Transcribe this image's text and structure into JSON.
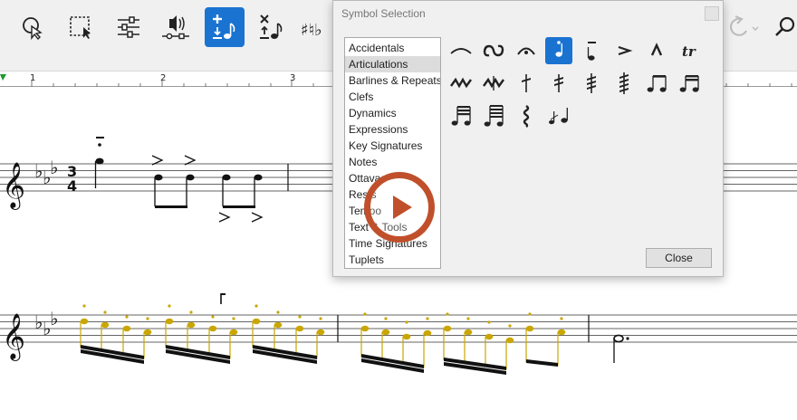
{
  "colors": {
    "accent": "#1a73d1",
    "selection_notes": "#c9a600",
    "play_overlay": "#c0502b"
  },
  "toolbar": {
    "buttons": [
      {
        "name": "select-tool",
        "icon": "cursor-icon"
      },
      {
        "name": "marquee-select",
        "icon": "marquee-select-icon"
      },
      {
        "name": "mixer",
        "icon": "sliders-icon"
      },
      {
        "name": "audio-playback",
        "icon": "speaker-icon"
      },
      {
        "name": "note-input",
        "icon": "note-input-icon",
        "active": true
      },
      {
        "name": "note-cross",
        "icon": "cross-note-icon"
      },
      {
        "name": "accidentals",
        "icon": "accidentals-icon"
      },
      {
        "name": "redo",
        "icon": "redo-icon"
      },
      {
        "name": "search",
        "icon": "search-icon"
      }
    ]
  },
  "ruler": {
    "labels": [
      "1",
      "2",
      "3"
    ]
  },
  "dialog": {
    "title": "Symbol Selection",
    "categories": [
      "Accidentals",
      "Articulations",
      "Barlines & Repeats",
      "Clefs",
      "Dynamics",
      "Expressions",
      "Key Signatures",
      "Notes",
      "Ottavas",
      "Rests",
      "Tempo",
      "Text & Tools",
      "Time Signatures",
      "Tuplets"
    ],
    "selected_category": "Articulations",
    "symbols": [
      "slur-icon",
      "turn-icon",
      "fermata-icon",
      "staccato-icon",
      "tenuto-icon",
      "accent-icon",
      "marcato-icon",
      "trill-icon",
      "mordent-icon",
      "inverted-mordent-icon",
      "single-tremolo-icon",
      "double-tremolo-icon",
      "triple-tremolo-icon",
      "quadruple-tremolo-icon",
      "eighth-beam-icon",
      "sixteenth-beam-icon",
      "thirtysecond-beam-icon",
      "sixtyfourth-beam-icon",
      "arpeggio-icon",
      "grace-note-icon"
    ],
    "symbol_labels": {
      "trill": "tr"
    },
    "selected_symbol_index": 3,
    "close_label": "Close"
  },
  "score": {
    "time_signature": {
      "top": "3",
      "bottom": "4"
    }
  }
}
